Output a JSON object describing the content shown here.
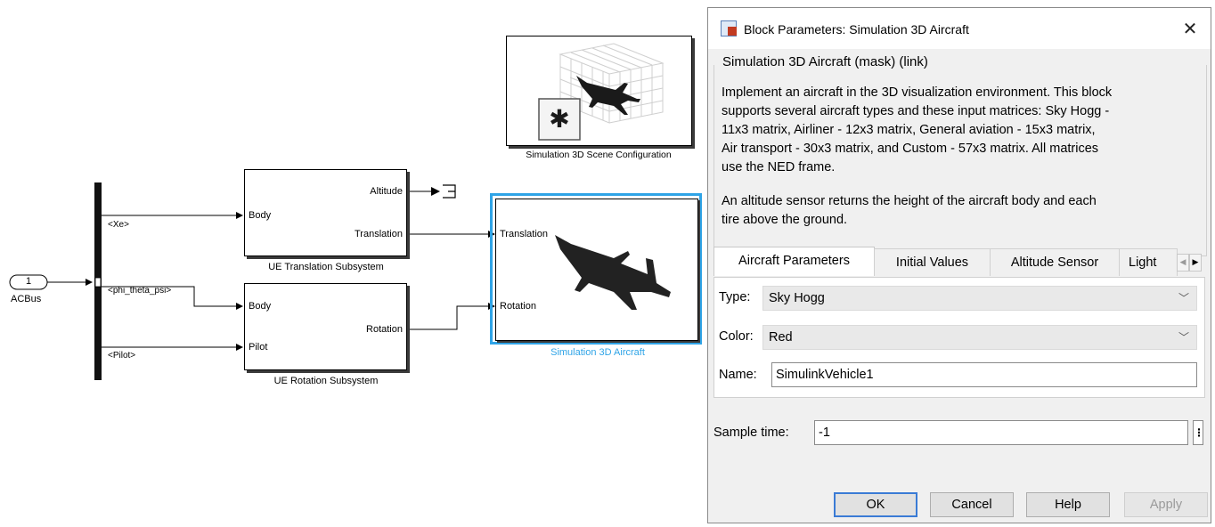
{
  "diagram": {
    "inport": {
      "number": "1",
      "name": "ACBus"
    },
    "bus_signals": [
      "<Xe>",
      "<phi_theta_psi>",
      "<Pilot>"
    ],
    "translation_subsystem": {
      "name": "UE Translation Subsystem",
      "in_ports": [
        "Body"
      ],
      "out_ports": [
        "Altitude",
        "Translation"
      ]
    },
    "rotation_subsystem": {
      "name": "UE Rotation Subsystem",
      "in_ports": [
        "Body",
        "Pilot"
      ],
      "out_ports": [
        "Rotation"
      ]
    },
    "scene_config": {
      "name": "Simulation 3D Scene Configuration"
    },
    "aircraft_block": {
      "name": "Simulation 3D Aircraft",
      "in_ports": [
        "Translation",
        "Rotation"
      ]
    },
    "selected_color": "#2fa4e7"
  },
  "dialog": {
    "title": "Block Parameters: Simulation 3D Aircraft",
    "mask_title": "Simulation 3D Aircraft (mask) (link)",
    "description_lines": [
      "Implement an aircraft in the 3D visualization environment. This block",
      "supports several aircraft types and these input matrices: Sky Hogg -",
      "11x3 matrix, Airliner - 12x3 matrix, General aviation - 15x3 matrix,",
      "Air transport - 30x3 matrix, and Custom - 57x3 matrix. All matrices",
      "use the NED frame."
    ],
    "description2_lines": [
      "An altitude sensor returns the height of the aircraft body and each",
      "tire above the ground."
    ],
    "tabs": [
      "Aircraft Parameters",
      "Initial Values",
      "Altitude Sensor",
      "Light"
    ],
    "fields": {
      "type_label": "Type:",
      "type_value": "Sky Hogg",
      "color_label": "Color:",
      "color_value": "Red",
      "name_label": "Name:",
      "name_value": "SimulinkVehicle1"
    },
    "sample_time": {
      "label": "Sample time:",
      "value": "-1"
    },
    "buttons": {
      "ok": "OK",
      "cancel": "Cancel",
      "help": "Help",
      "apply": "Apply"
    }
  }
}
